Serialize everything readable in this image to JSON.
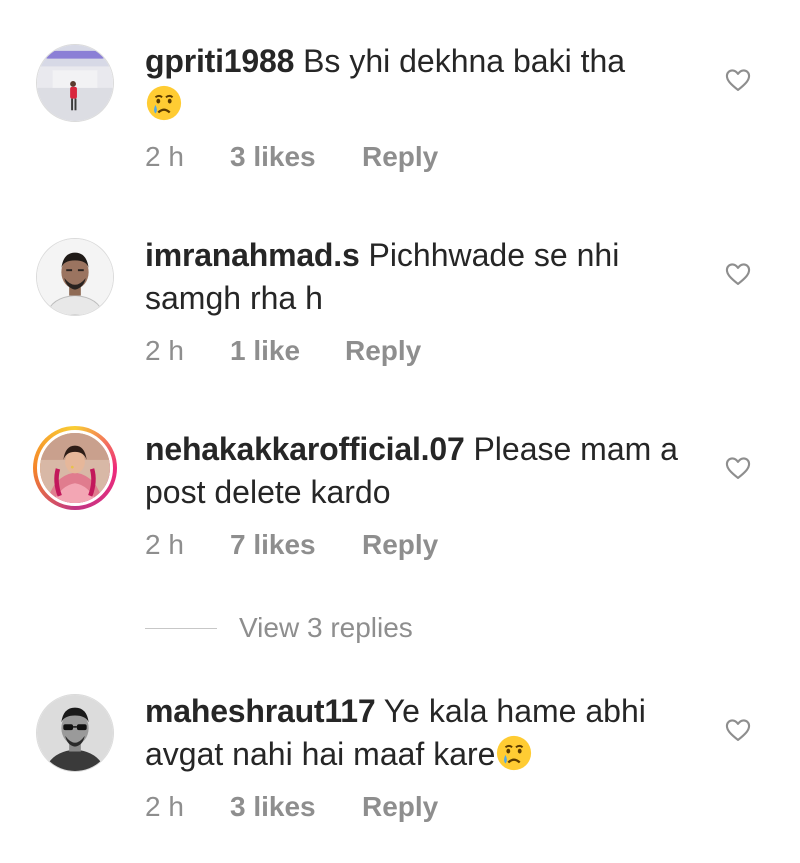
{
  "comments": [
    {
      "username": "gpriti1988",
      "text": "Bs yhi dekhna baki tha",
      "emoji": "crying-face",
      "time": "2 h",
      "likes": "3 likes",
      "reply": "Reply"
    },
    {
      "username": "imranahmad.s",
      "text": "Pichhwade se nhi samgh rha h",
      "time": "2 h",
      "likes": "1 like",
      "reply": "Reply"
    },
    {
      "username": "nehakakkarofficial.07",
      "text": "Please mam a post delete kardo",
      "time": "2 h",
      "likes": "7 likes",
      "reply": "Reply",
      "view_replies": "View 3 replies"
    },
    {
      "username": "maheshraut117",
      "text": "Ye kala hame abhi avgat nahi hai maaf kare",
      "emoji": "crying-face",
      "time": "2 h",
      "likes": "3 likes",
      "reply": "Reply"
    }
  ],
  "icons": {
    "like": "heart-outline-icon",
    "emoji": "crying-face"
  },
  "colors": {
    "text": "#262626",
    "muted": "#8e8e8e",
    "story_ring": [
      "#f9ce34",
      "#ee2a7b",
      "#c13584",
      "#f58529"
    ]
  }
}
